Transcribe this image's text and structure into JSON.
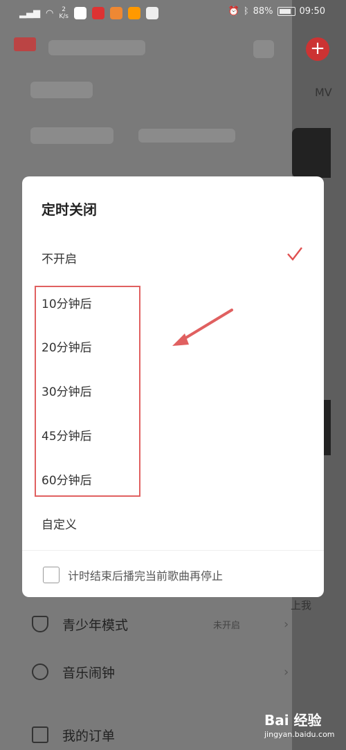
{
  "status": {
    "battery": "88%",
    "time": "09:50",
    "speed": "2",
    "speed_unit": "K/s"
  },
  "background": {
    "mv_label": "MV",
    "side_text": "上我"
  },
  "dialog": {
    "title": "定时关闭",
    "options": [
      {
        "label": "不开启",
        "selected": true
      },
      {
        "label": "10分钟后"
      },
      {
        "label": "20分钟后"
      },
      {
        "label": "30分钟后"
      },
      {
        "label": "45分钟后"
      },
      {
        "label": "60分钟后"
      },
      {
        "label": "自定义"
      }
    ],
    "footer_checkbox_label": "计时结束后播完当前歌曲再停止"
  },
  "menu": [
    {
      "label": "青少年模式",
      "value": "未开启",
      "icon": "shield-icon"
    },
    {
      "label": "音乐闹钟",
      "value": "",
      "icon": "clock-icon"
    },
    {
      "label": "我的订单",
      "value": "",
      "icon": "document-icon"
    }
  ],
  "watermark": {
    "text": "Bai 经验",
    "subtext": "jingyan.baidu.com"
  },
  "colors": {
    "accent": "#e05050",
    "annotation": "#e06060"
  }
}
